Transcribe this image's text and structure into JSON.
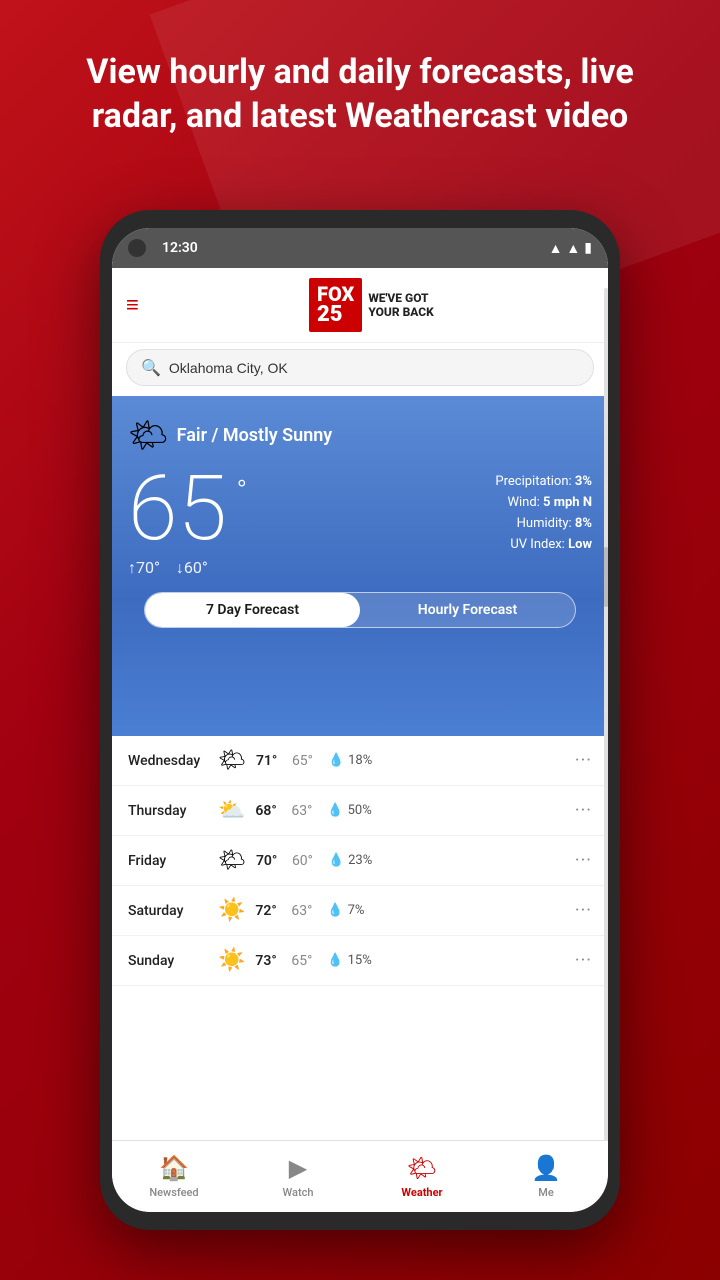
{
  "background": {
    "headline": "View hourly and daily forecasts, live radar, and latest Weathercast video"
  },
  "status_bar": {
    "time": "12:30",
    "wifi": "▲",
    "signal": "▲",
    "battery": "▮"
  },
  "header": {
    "menu_icon": "≡",
    "logo_fox": "FOX",
    "logo_number": "25",
    "logo_tagline_line1": "WE'VE GOT",
    "logo_tagline_line2": "YOUR BACK"
  },
  "search": {
    "placeholder": "Oklahoma City, OK",
    "value": "Oklahoma City, OK",
    "icon": "🔍"
  },
  "weather": {
    "condition_icon": "🌤",
    "condition_text": "Fair / Mostly Sunny",
    "temperature": "65",
    "degree_symbol": "°",
    "temp_high": "↑70°",
    "temp_low": "↓60°",
    "precipitation": "3%",
    "wind": "5 mph N",
    "humidity": "8%",
    "uv_index": "Low",
    "precipitation_label": "Precipitation:",
    "wind_label": "Wind:",
    "humidity_label": "Humidity:",
    "uv_label": "UV Index:"
  },
  "forecast_tabs": {
    "tab1": "7 Day Forecast",
    "tab2": "Hourly Forecast"
  },
  "forecast_days": [
    {
      "day": "Wednesday",
      "icon": "🌤",
      "high": "71°",
      "low": "65°",
      "precip": "18%"
    },
    {
      "day": "Thursday",
      "icon": "⛅",
      "high": "68°",
      "low": "63°",
      "precip": "50%"
    },
    {
      "day": "Friday",
      "icon": "🌤",
      "high": "70°",
      "low": "60°",
      "precip": "23%"
    },
    {
      "day": "Saturday",
      "icon": "☀️",
      "high": "72°",
      "low": "63°",
      "precip": "7%"
    },
    {
      "day": "Sunday",
      "icon": "☀️",
      "high": "73°",
      "low": "65°",
      "precip": "15%"
    }
  ],
  "bottom_nav": {
    "newsfeed_label": "Newsfeed",
    "watch_label": "Watch",
    "weather_label": "Weather",
    "me_label": "Me"
  }
}
